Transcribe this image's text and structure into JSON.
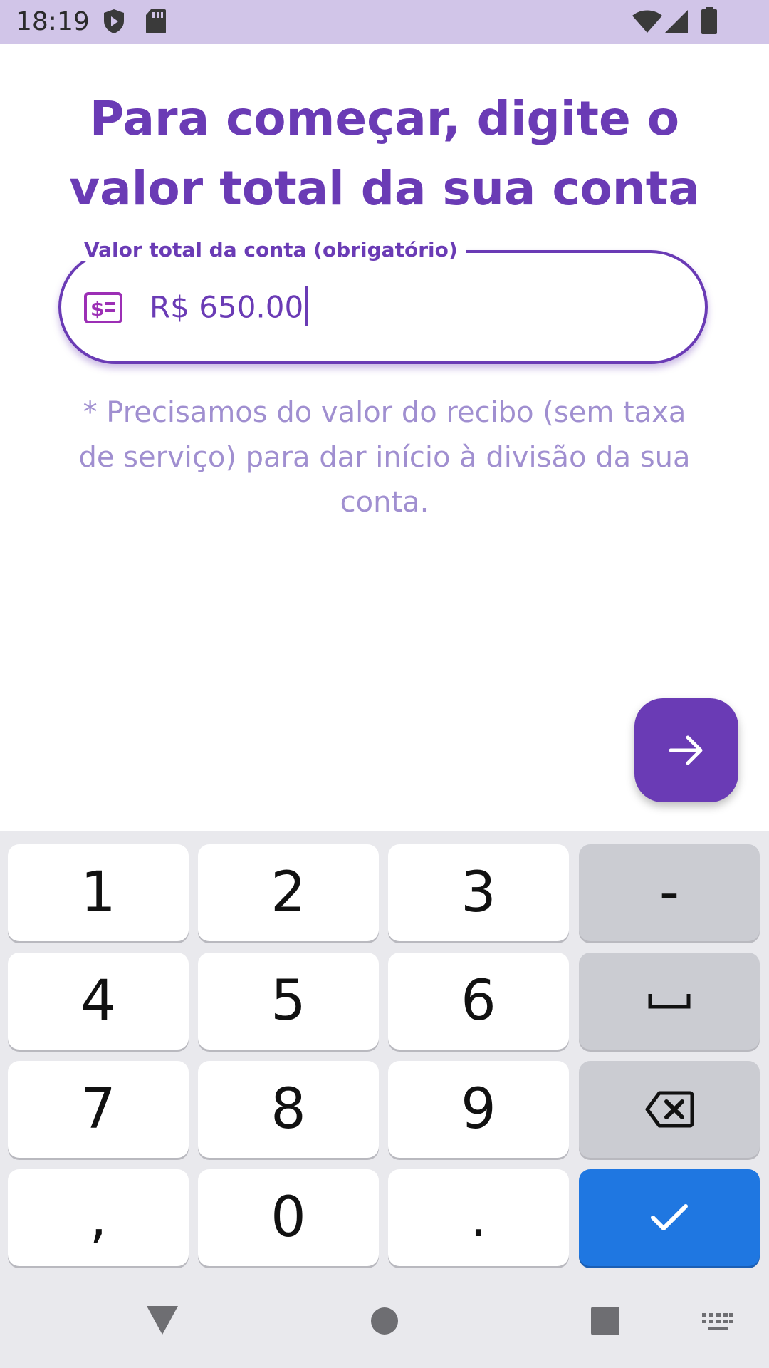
{
  "status_bar": {
    "time": "18:19",
    "icons": [
      "play-protect-icon",
      "sd-card-icon",
      "wifi-icon",
      "signal-icon",
      "battery-icon"
    ]
  },
  "title": "Para começar, digite o valor total da sua conta",
  "amount_field": {
    "label": "Valor total da conta (obrigatório)",
    "value": "R$ 650.00",
    "icon": "price-tag-icon"
  },
  "hint": "* Precisamos do valor do recibo (sem taxa de serviço) para dar início à divisão da sua conta.",
  "next_button": {
    "icon": "arrow-right-icon"
  },
  "keyboard": {
    "rows": [
      [
        "1",
        "2",
        "3",
        "-"
      ],
      [
        "4",
        "5",
        "6",
        "space"
      ],
      [
        "7",
        "8",
        "9",
        "backspace"
      ],
      [
        ",",
        "0",
        ".",
        "done"
      ]
    ],
    "labels": {
      "k1": "1",
      "k2": "2",
      "k3": "3",
      "minus": "-",
      "k4": "4",
      "k5": "5",
      "k6": "6",
      "k7": "7",
      "k8": "8",
      "k9": "9",
      "comma": ",",
      "k0": "0",
      "period": "."
    }
  },
  "nav_bar": {
    "icons": [
      "back-icon",
      "home-icon",
      "recents-icon",
      "keyboard-switch-icon"
    ]
  },
  "colors": {
    "primary": "#6a3bb5",
    "status_bar": "#d1c5e8",
    "hint_text": "#a08fd0",
    "done_key": "#1f77e1",
    "keyboard_bg": "#e9e9ed"
  }
}
